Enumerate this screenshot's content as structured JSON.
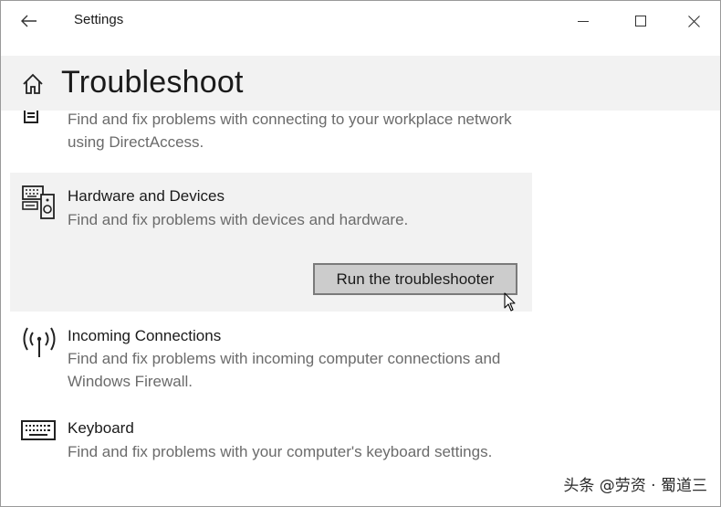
{
  "window": {
    "title": "Settings"
  },
  "header": {
    "title": "Troubleshoot"
  },
  "items": [
    {
      "id": "directaccess",
      "desc": "Find and fix problems with connecting to your workplace network using DirectAccess."
    },
    {
      "id": "hardware",
      "name": "Hardware and Devices",
      "desc": "Find and fix problems with devices and hardware.",
      "button": "Run the troubleshooter"
    },
    {
      "id": "incoming",
      "name": "Incoming Connections",
      "desc": "Find and fix problems with incoming computer connections and Windows Firewall."
    },
    {
      "id": "keyboard",
      "name": "Keyboard",
      "desc": "Find and fix problems with your computer's keyboard settings."
    }
  ],
  "watermark": "头条 @劳资 · 蜀道三",
  "colors": {
    "header_bg": "#f2f2f2",
    "selected_bg": "#f2f2f2",
    "button_bg": "#cccccc",
    "button_border": "#7a7a7a",
    "desc_text": "#6b6b6b"
  }
}
